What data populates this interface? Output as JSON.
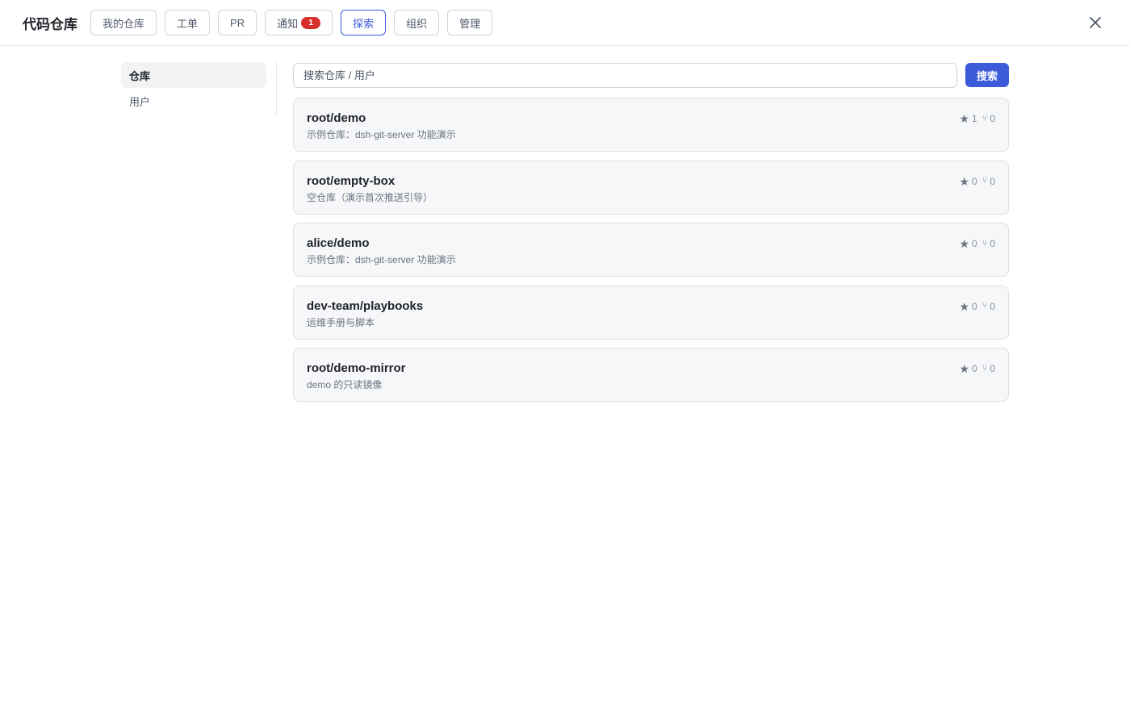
{
  "header": {
    "title": "代码仓库",
    "tabs": [
      {
        "label": "我的仓库"
      },
      {
        "label": "工单"
      },
      {
        "label": "PR"
      },
      {
        "label": "通知",
        "badge": "1"
      },
      {
        "label": "探索",
        "active": true
      },
      {
        "label": "组织"
      },
      {
        "label": "管理"
      }
    ],
    "close_icon": "close-icon"
  },
  "sidebar": {
    "items": [
      {
        "label": "仓库",
        "active": true
      },
      {
        "label": "用户"
      }
    ]
  },
  "search": {
    "placeholder": "搜索仓库 / 用户",
    "value": "",
    "button_label": "搜索"
  },
  "repos": [
    {
      "name": "root/demo",
      "description": "示例仓库：dsh-git-server 功能演示",
      "stars": "1",
      "forks": "0"
    },
    {
      "name": "root/empty-box",
      "description": "空仓库（演示首次推送引导）",
      "stars": "0",
      "forks": "0"
    },
    {
      "name": "alice/demo",
      "description": "示例仓库：dsh-git-server 功能演示",
      "stars": "0",
      "forks": "0"
    },
    {
      "name": "dev-team/playbooks",
      "description": "运维手册与脚本",
      "stars": "0",
      "forks": "0"
    },
    {
      "name": "root/demo-mirror",
      "description": "demo 的只读镜像",
      "stars": "0",
      "forks": "0"
    }
  ],
  "colors": {
    "accent": "#3b5bdb",
    "badge": "#d7302c",
    "card_bg": "#f6f7f9"
  }
}
